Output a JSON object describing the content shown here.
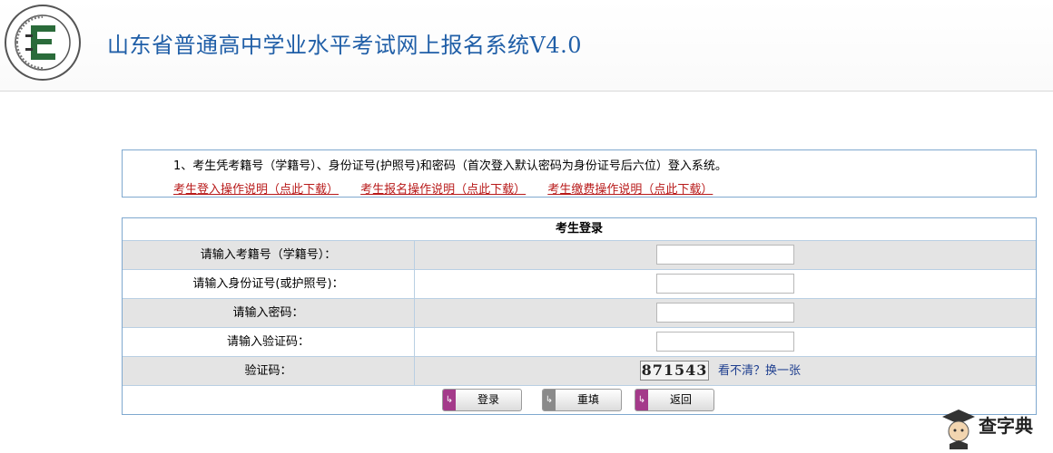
{
  "header": {
    "title": "山东省普通高中学业水平考试网上报名系统V4.0",
    "logo_icon": "provincial-exam-logo"
  },
  "notice": {
    "text": "1、考生凭考籍号（学籍号）、身份证号(护照号)和密码（首次登入默认密码为身份证号后六位）登入系统。",
    "links": [
      "考生登入操作说明（点此下载）",
      "考生报名操作说明（点此下载）",
      "考生缴费操作说明（点此下载）"
    ]
  },
  "login": {
    "title": "考生登录",
    "labels": {
      "exam_id": "请输入考籍号（学籍号）：",
      "id_card": "请输入身份证号(或护照号)：",
      "password": "请输入密码：",
      "captcha_input": "请输入验证码：",
      "captcha": "验证码："
    },
    "captcha_value": "871543",
    "refresh_text": "看不清？换一张",
    "buttons": {
      "login": "登录",
      "reset": "重填",
      "back": "返回"
    },
    "button_colors": {
      "login": "#a43a8a",
      "reset": "#8a8a8a",
      "back": "#a43a8a"
    }
  },
  "watermark": {
    "text": "查字典"
  }
}
